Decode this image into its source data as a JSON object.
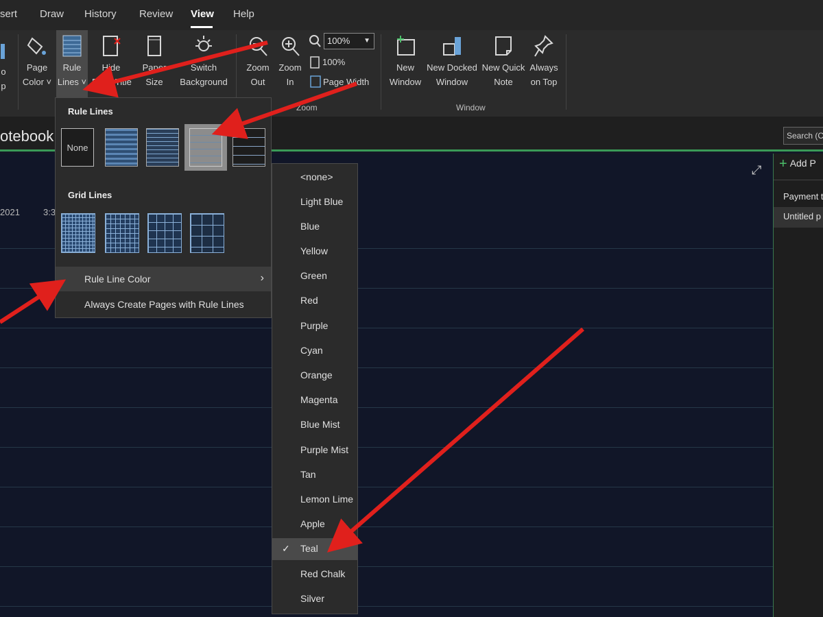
{
  "tabs": [
    {
      "label": "sert",
      "active": false
    },
    {
      "label": "Draw",
      "active": false
    },
    {
      "label": "History",
      "active": false
    },
    {
      "label": "Review",
      "active": false
    },
    {
      "label": "View",
      "active": true
    },
    {
      "label": "Help",
      "active": false
    }
  ],
  "ribbon": {
    "partial_left": {
      "line1": "o",
      "line2": "p"
    },
    "page_color": {
      "line1": "Page",
      "line2": "Color ˅"
    },
    "rule_lines": {
      "line1": "Rule",
      "line2": "Lines ˅"
    },
    "hide_title": {
      "line1": "Hide",
      "line2": "Page Title"
    },
    "paper_size": {
      "line1": "Paper",
      "line2": "Size"
    },
    "switch_bg": {
      "line1": "Switch",
      "line2": "Background"
    },
    "zoom_out": {
      "line1": "Zoom",
      "line2": "Out"
    },
    "zoom_in": {
      "line1": "Zoom",
      "line2": "In"
    },
    "zoom_value": "100%",
    "zoom_100": "100%",
    "page_width": "Page Width",
    "zoom_group": "Zoom",
    "new_window": {
      "line1": "New",
      "line2": "Window"
    },
    "new_docked": {
      "line1": "New Docked",
      "line2": "Window"
    },
    "new_quick": {
      "line1": "New Quick",
      "line2": "Note"
    },
    "always_top": {
      "line1": "Always",
      "line2": "on Top"
    },
    "window_group": "Window"
  },
  "notebook": {
    "title": "otebook",
    "search_placeholder": "Search (C",
    "date": "2021",
    "time": "3:3"
  },
  "right_pane": {
    "add_page": "Add P",
    "pages": [
      "Payment t",
      "Untitled p"
    ]
  },
  "rule_menu": {
    "rule_lines_heading": "Rule Lines",
    "none_label": "None",
    "grid_lines_heading": "Grid Lines",
    "rule_line_color": "Rule Line Color",
    "always_create": "Always Create Pages with Rule Lines"
  },
  "color_menu": {
    "items": [
      "<none>",
      "Light Blue",
      "Blue",
      "Yellow",
      "Green",
      "Red",
      "Purple",
      "Cyan",
      "Orange",
      "Magenta",
      "Blue Mist",
      "Purple Mist",
      "Tan",
      "Lemon Lime",
      "Apple",
      "Teal",
      "Red Chalk",
      "Silver"
    ],
    "checked": "Teal"
  },
  "colors": {
    "accent_green": "#3a9a58",
    "annotation_red": "#e0201c",
    "rule_blue": "#4a7fb8"
  }
}
